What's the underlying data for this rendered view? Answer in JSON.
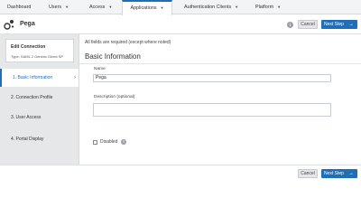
{
  "nav": {
    "tabs": [
      {
        "label": "Dashboard",
        "caret": false
      },
      {
        "label": "Users",
        "caret": true
      },
      {
        "label": "Access",
        "caret": true
      },
      {
        "label": "Applications",
        "caret": true
      },
      {
        "label": "Authentication Clients",
        "caret": true
      },
      {
        "label": "Platform",
        "caret": true
      }
    ],
    "active_tab": "Applications",
    "caret_glyph": "▼"
  },
  "header": {
    "connection_name": "Pega",
    "info_icon": "i",
    "cancel_label": "Cancel",
    "next_label": "Next Step",
    "arrow_glyph": "→"
  },
  "sidebar": {
    "title": "Edit Connection",
    "type_text": "Type: SAML 2 Generic Direct SP",
    "steps": [
      {
        "label": "1. Basic Information",
        "active": true
      },
      {
        "label": "2. Connection Profile",
        "active": false
      },
      {
        "label": "3. User Access",
        "active": false
      },
      {
        "label": "4. Portal Display",
        "active": false
      }
    ],
    "active_arrow": "›"
  },
  "main": {
    "required_note": "All fields are required (except where noted)",
    "section_title": "Basic Information",
    "name_label": "Name",
    "name_value": "Pega",
    "description_label": "Description (optional)",
    "description_value": "",
    "disabled_label": "Disabled",
    "help_icon": "?"
  },
  "footer": {
    "cancel_label": "Cancel",
    "next_label": "Next Step",
    "arrow_glyph": "→"
  },
  "colors": {
    "accent": "#1f6fb8",
    "sidebar_bg": "#e6e7e9",
    "nav_bg": "#f3f4f6"
  }
}
